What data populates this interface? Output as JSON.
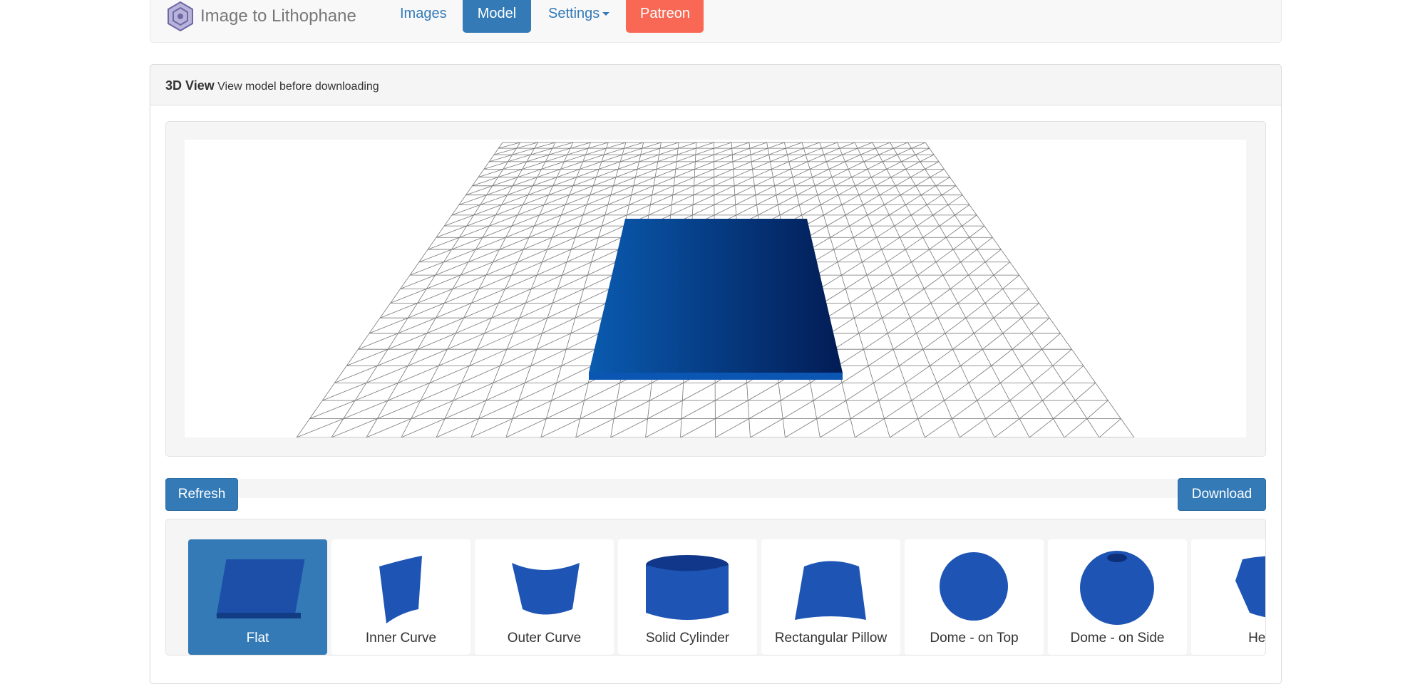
{
  "navbar": {
    "brand": "Image to Lithophane",
    "links": [
      {
        "label": "Images"
      },
      {
        "label": "Model"
      },
      {
        "label": "Settings"
      },
      {
        "label": "Patreon"
      }
    ]
  },
  "panel": {
    "title": "3D View",
    "subtitle": "View model before downloading"
  },
  "actions": {
    "refresh": "Refresh",
    "download": "Download"
  },
  "colors": {
    "primary": "#337ab7",
    "patreon": "#f96854",
    "model": "#0a4a9a"
  },
  "shapes": [
    {
      "label": "Flat",
      "active": true
    },
    {
      "label": "Inner Curve"
    },
    {
      "label": "Outer Curve"
    },
    {
      "label": "Solid Cylinder"
    },
    {
      "label": "Rectangular Pillow"
    },
    {
      "label": "Dome - on Top"
    },
    {
      "label": "Dome - on Side"
    },
    {
      "label": "Hea"
    }
  ]
}
